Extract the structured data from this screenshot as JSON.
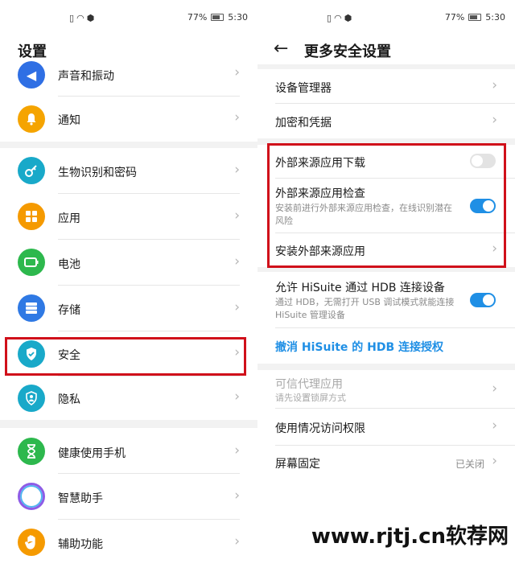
{
  "status": {
    "battery": "77%",
    "time": "5:30",
    "icons": [
      "sim-icon",
      "wifi-icon",
      "shield-icon"
    ]
  },
  "left": {
    "title": "设置",
    "items": [
      {
        "label": "声音和振动",
        "icon": "speaker-icon",
        "color": "#2f6fe4"
      },
      {
        "label": "通知",
        "icon": "bell-icon",
        "color": "#f5a400"
      },
      {
        "label": "生物识别和密码",
        "icon": "key-icon",
        "color": "#19a9c9"
      },
      {
        "label": "应用",
        "icon": "apps-grid-icon",
        "color": "#f59a00"
      },
      {
        "label": "电池",
        "icon": "battery-icon",
        "color": "#2db84d"
      },
      {
        "label": "存储",
        "icon": "storage-icon",
        "color": "#2f79e4"
      },
      {
        "label": "安全",
        "icon": "shield-check-icon",
        "color": "#19a9c9"
      },
      {
        "label": "隐私",
        "icon": "privacy-icon",
        "color": "#19a9c9"
      },
      {
        "label": "健康使用手机",
        "icon": "hourglass-icon",
        "color": "#2db84d"
      },
      {
        "label": "智慧助手",
        "icon": "assistant-ring-icon",
        "color": "#8e5ce6"
      },
      {
        "label": "辅助功能",
        "icon": "hand-icon",
        "color": "#f59a00"
      }
    ]
  },
  "right": {
    "title": "更多安全设置",
    "device_manager": "设备管理器",
    "encryption": "加密和凭据",
    "external_download": "外部来源应用下载",
    "external_check": "外部来源应用检查",
    "external_check_sub": "安装前进行外部来源应用检查，在线识别潜在风险",
    "install_external": "安装外部来源应用",
    "hisuite_hdb": "允许 HiSuite 通过 HDB 连接设备",
    "hisuite_hdb_sub": "通过 HDB，无需打开 USB 调试模式就能连接 HiSuite 管理设备",
    "revoke_hdb": "撤消 HiSuite 的 HDB 连接授权",
    "trusted_agents": "可信代理应用",
    "trusted_agents_sub": "请先设置锁屏方式",
    "usage_access": "使用情况访问权限",
    "screen_pinning": "屏幕固定",
    "screen_pinning_value": "已关闭",
    "toggles": {
      "external_download": false,
      "external_check": true,
      "hisuite_hdb": true
    }
  },
  "watermark": "www.rjtj.cn软荐网",
  "colors": {
    "accent": "#1f8fe5",
    "highlight": "#d0101a"
  }
}
